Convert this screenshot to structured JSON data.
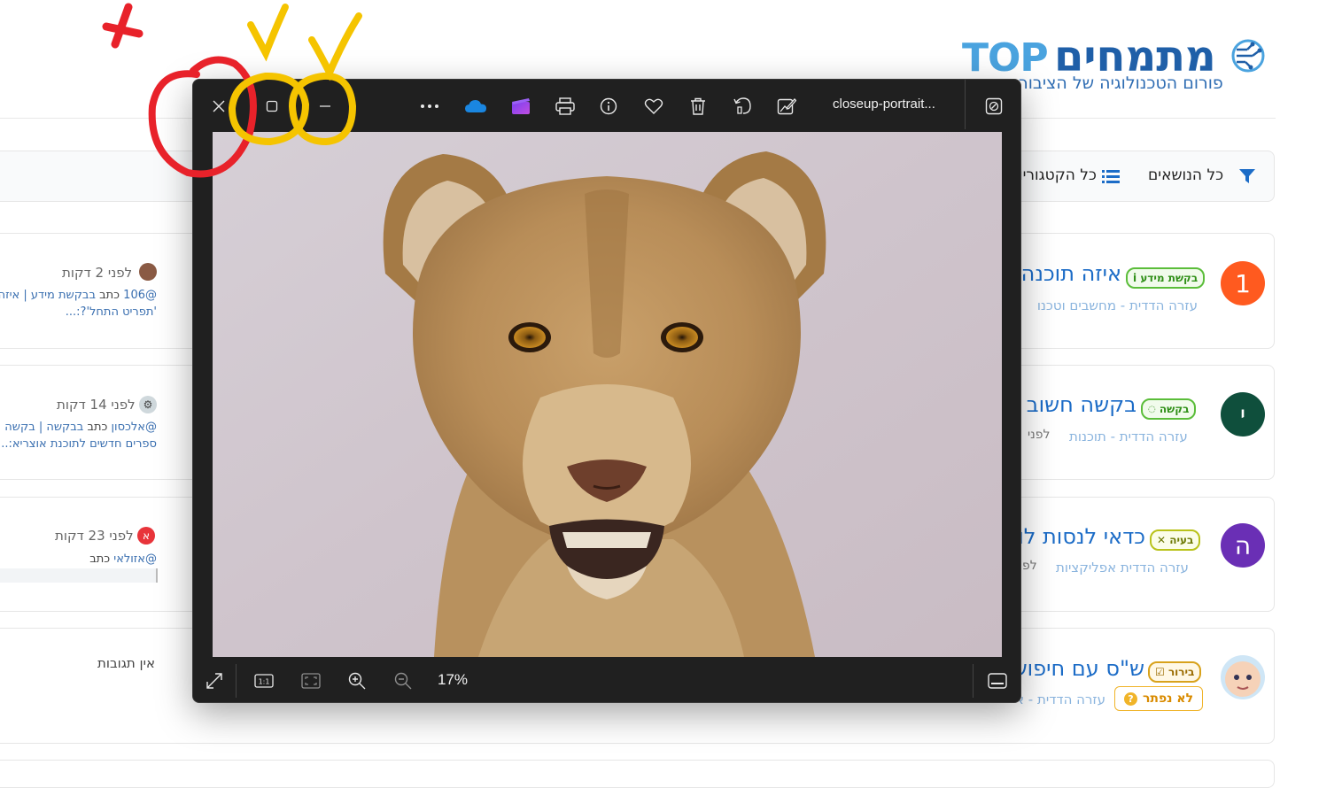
{
  "forum": {
    "logo_latin": "TOP",
    "logo_hebrew": "מתמחים",
    "tagline": "פורום הטכנולוגיה של הציבור",
    "filters": {
      "all_topics": "כל הנושאים",
      "all_categories": "כל הקטגוריו"
    },
    "topics": [
      {
        "avatar_letter": "1",
        "avatar_color": "#ff5a1f",
        "badge": "בקשת מידע",
        "badge_icon": "i",
        "title": "איזה תוכנה",
        "crumb": "עזרה הדדית - מחשבים וטכנו",
        "last_time": "לפני 2 דקות",
        "last_line1_user": "@106",
        "last_line1_mid": " כתב ",
        "last_line1_rest": "בבקשת מידע | איזה",
        "last_line2": "'תפריט התחל'?:..."
      },
      {
        "avatar_letter": "י",
        "avatar_color": "#0f4f3c",
        "badge": "בקשה",
        "badge_icon": "💬",
        "title": "בקשה חשוב",
        "crumb": "עזרה הדדית - תוכנות",
        "crumb_extra": "לפני",
        "last_time": "לפני 14 דקות",
        "last_line1_user": "@אלכסון",
        "last_line1_mid": " כתב ",
        "last_line1_rest": "בבקשה | בקשה ח",
        "last_line2": "ספרים חדשים לתוכנת אוצריא:..."
      },
      {
        "avatar_letter": "ה",
        "avatar_color": "#6a2fb5",
        "badge": "בעיה",
        "badge_icon": "✕",
        "title": "כדאי לנסות לו",
        "crumb": "עזרה הדדית אפליקציות",
        "crumb_extra": "לפ",
        "last_time": "לפני 23 דקות",
        "mini_avatar_letter": "א",
        "last_line1_user": "@אזולאי",
        "last_line1_mid": " כתב ",
        "last_line1_rest": "",
        "last_line2": ""
      },
      {
        "avatar_letter": "",
        "avatar_color": "#cfe6f6",
        "badge": "בירור",
        "badge_icon": "☑",
        "title": "ש\"ס עם חיפוש",
        "crumb": "עזרה הדדית - אפליקציות",
        "solved_label": "לא נפתר",
        "no_replies": "אין תגובות"
      }
    ]
  },
  "viewer": {
    "filename": "closeup-portrait...",
    "zoom": "17%",
    "toolbar_icons": [
      "close-icon",
      "maximize-icon",
      "minimize-icon",
      "more-icon",
      "onedrive-icon",
      "clipchamp-icon",
      "print-icon",
      "info-icon",
      "favorite-icon",
      "delete-icon",
      "rotate-icon",
      "edit-image-icon",
      "slideshow-icon"
    ],
    "bottom_icons": [
      "fullscreen-icon",
      "actual-size-icon",
      "fit-icon",
      "zoom-in-icon",
      "zoom-out-icon",
      "filmstrip-icon"
    ]
  },
  "annotations": {
    "red": "#e8222a",
    "yellow": "#f5c400"
  },
  "colors": {
    "accent": "#1c6cc7",
    "viewer_bg": "#202020"
  }
}
